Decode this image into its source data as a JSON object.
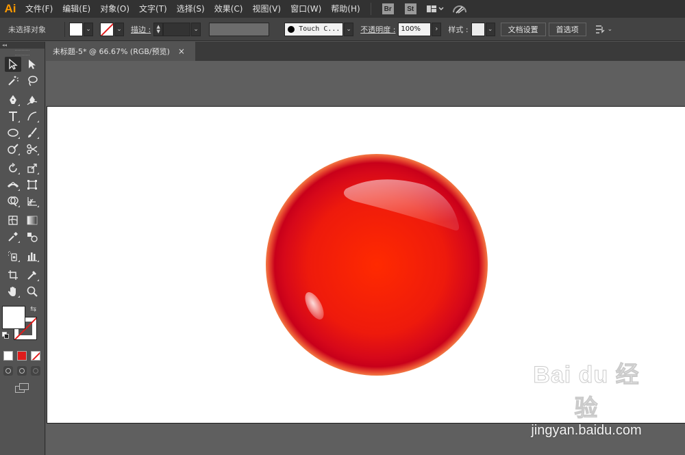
{
  "app": {
    "logo": "Ai"
  },
  "menu": {
    "items": [
      "文件(F)",
      "编辑(E)",
      "对象(O)",
      "文字(T)",
      "选择(S)",
      "效果(C)",
      "视图(V)",
      "窗口(W)",
      "帮助(H)"
    ],
    "bridge_label": "Br",
    "stock_label": "St",
    "icons": [
      "workspace-layout-icon",
      "gpu-performance-icon"
    ]
  },
  "control_bar": {
    "selection_status": "未选择对象",
    "stroke_label": "描边 :",
    "brush_label": "Touch C...",
    "opacity_label": "不透明度 :",
    "opacity_value": "100%",
    "style_label": "样式 :",
    "doc_setup_label": "文档设置",
    "preferences_label": "首选项"
  },
  "document": {
    "tab_title": "未标题-5* @ 66.67% (RGB/预览)",
    "close_glyph": "×"
  },
  "artwork": {
    "description_colors": {
      "center": "#ff2a00",
      "mid": "#e81010",
      "rim": "#c8001a",
      "outer_glow": "#f06a3a"
    }
  },
  "watermark": {
    "logo_text": "Bai du 经验",
    "url": "jingyan.baidu.com"
  }
}
